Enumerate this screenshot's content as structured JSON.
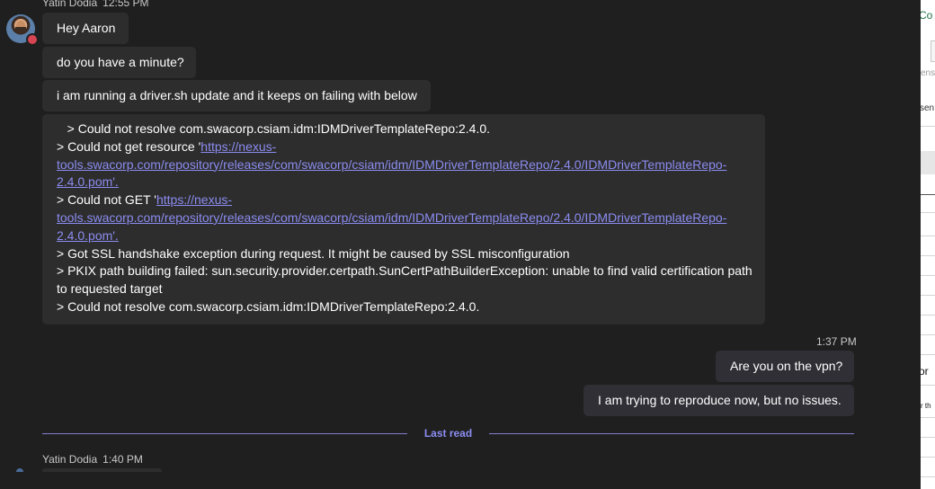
{
  "chat": {
    "first_group": {
      "sender": "Yatin Dodia",
      "time": "12:55 PM"
    },
    "messages": [
      {
        "text": "Hey Aaron"
      },
      {
        "text": "do you have a minute?"
      },
      {
        "text": "i am running a driver.sh update and it keeps on failing with below"
      }
    ],
    "log": {
      "line1": "   > Could not resolve com.swacorp.csiam.idm:IDMDriverTemplateRepo:2.4.0.",
      "line2_prefix": "> Could not get resource '",
      "link1_part1": "https://nexus-",
      "link1_part2": "tools.swacorp.com/repository/releases/com/swacorp/csiam/idm/IDMDriverTemplateRepo/2.4.0/IDMDriverTemplateRepo-",
      "link1_part3": "2.4.0.pom'.",
      "line5_prefix": "> Could not GET '",
      "link2_part1": "https://nexus-",
      "link2_part2": "tools.swacorp.com/repository/releases/com/swacorp/csiam/idm/IDMDriverTemplateRepo/2.4.0/IDMDriverTemplateRepo-",
      "link2_part3": "2.4.0.pom'.",
      "line8": "> Got SSL handshake exception during request. It might be caused by SSL misconfiguration",
      "line9": "> PKIX path building failed: sun.security.provider.certpath.SunCertPathBuilderException: unable to find valid certification path",
      "line10": "to requested target",
      "line11": "> Could not resolve com.swacorp.csiam.idm:IDMDriverTemplateRepo:2.4.0."
    },
    "my_time": "1:37 PM",
    "my_messages": [
      {
        "text": "Are you on the vpn?"
      },
      {
        "text": "I am trying to reproduce now, but no issues."
      }
    ],
    "divider_label": "Last read",
    "second_group": {
      "sender": "Yatin Dodia",
      "time": "1:40 PM"
    }
  },
  "excel_fragment": {
    "t1": "Co",
    "t2": "ens",
    "t3": "sen",
    "t4": "or",
    "t5": "r th"
  },
  "colors": {
    "background": "#1f1f1f",
    "bubble": "#2d2d2d",
    "link": "#8b8cf0",
    "divider": "#7f7fd1",
    "presence_busy": "#d74553"
  }
}
